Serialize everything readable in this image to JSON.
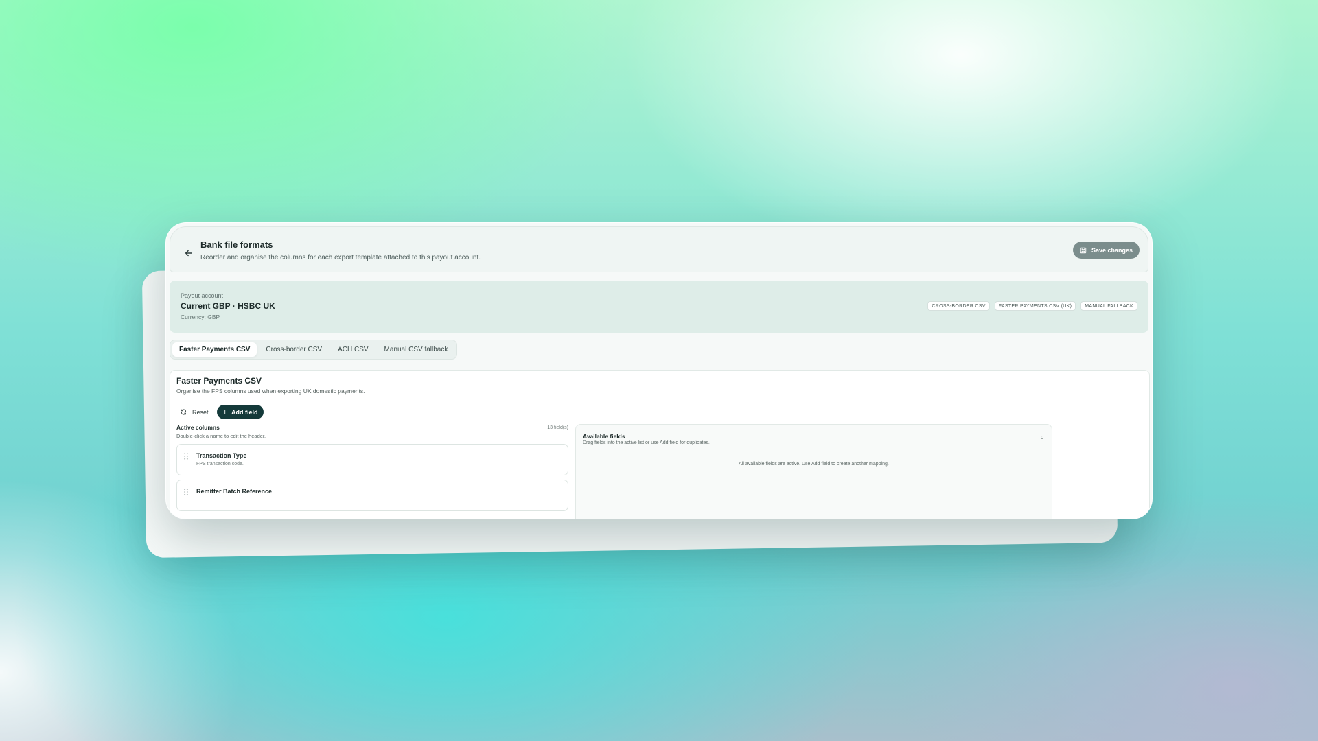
{
  "header": {
    "title": "Bank file formats",
    "subtitle": "Reorder and organise the columns for each export template attached to this payout account.",
    "back_icon": "arrow-left-icon",
    "save_label": "Save changes",
    "save_icon": "save-icon"
  },
  "account": {
    "label": "Payout account",
    "name": "Current GBP · HSBC UK",
    "currency": "Currency: GBP",
    "badges": [
      "CROSS-BORDER CSV",
      "FASTER PAYMENTS CSV (UK)",
      "MANUAL FALLBACK"
    ]
  },
  "tabs": [
    {
      "label": "Faster Payments CSV",
      "active": true
    },
    {
      "label": "Cross-border CSV",
      "active": false
    },
    {
      "label": "ACH CSV",
      "active": false
    },
    {
      "label": "Manual CSV fallback",
      "active": false
    }
  ],
  "content": {
    "title": "Faster Payments CSV",
    "subtitle": "Organise the FPS columns used when exporting UK domestic payments.",
    "reset_label": "Reset",
    "add_label": "Add field"
  },
  "active_columns": {
    "title": "Active columns",
    "subtitle": "Double-click a name to edit the header.",
    "count": "13 field(s)",
    "fields": [
      {
        "name": "Transaction Type",
        "desc": "FPS transaction code."
      },
      {
        "name": "Remitter Batch Reference",
        "desc": ""
      }
    ]
  },
  "available_fields": {
    "title": "Available fields",
    "subtitle": "Drag fields into the active list or use Add field for duplicates.",
    "count": "0",
    "empty_message": "All available fields are active. Use Add field to create another mapping."
  },
  "colors": {
    "primary_button": "#143a3a",
    "save_button": "#7b8d8c",
    "account_panel": "#deede8"
  }
}
